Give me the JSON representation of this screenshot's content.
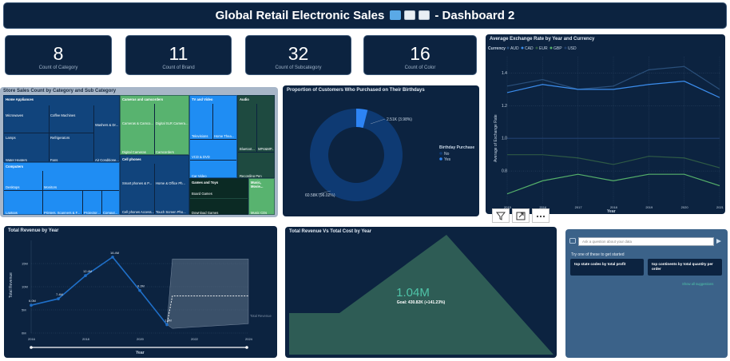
{
  "header": {
    "title_left": "Global Retail Electronic Sales",
    "title_right": "- Dashboard 2"
  },
  "kpis": [
    {
      "value": "8",
      "label": "Count of Category"
    },
    {
      "value": "11",
      "label": "Count of Brand"
    },
    {
      "value": "32",
      "label": "Count of Subcategory"
    },
    {
      "value": "16",
      "label": "Count of Color"
    }
  ],
  "treemap": {
    "title": "Store Sales Count by Category and Sub Category",
    "blocks": {
      "home_appliances": "Home Appliances",
      "microwaves": "Microwaves",
      "coffee_machines": "Coffee Machines",
      "lamps": "Lamps",
      "refrigerators": "Refrigerators",
      "washers": "Washers & Dr...",
      "water_heaters": "Water Heaters",
      "fans": "Fans",
      "air_conditioners": "Air Conditione...",
      "cameras": "Cameras and camcorders",
      "cameras_camco": "Cameras & Camco...",
      "digital_slr": "Digital SLR Camera...",
      "digital_cameras": "Digital Cameras",
      "camcorders": "Camcorders",
      "tv_video": "TV and Video",
      "televisions": "Televisions",
      "home_theater": "Home Thea...",
      "vcd_dvd": "VCD & DVD",
      "car_video": "Car Video",
      "audio": "Audio",
      "bluetooth": "Bluetoot...",
      "mp4": "MP4&MP...",
      "recording_pen": "Recording Pen",
      "computers": "Computers",
      "desktops": "Desktops",
      "monitors": "Monitors",
      "laptops": "Laptops",
      "printers": "Printers, Scanners & F...",
      "projectors": "Projector...",
      "computers_acc": "Comput...",
      "cell_phones": "Cell phones",
      "smart_phones": "Smart phones & P...",
      "home_office": "Home & Office Ph...",
      "cell_phones_acc": "Cell phones Access...",
      "touch_screen": "Touch Screen Pho...",
      "games": "Games and Toys",
      "board_games": "Board Games",
      "download_games": "Download Games",
      "music": "Music, Movie...",
      "music_cds": "Music CDs"
    }
  },
  "donut": {
    "title": "Proportion of Customers Who Purchased on Their Birthdays",
    "label_yes": "2.51K (3.98%)",
    "label_no": "60.58K (96.02%)",
    "legend_title": "Birthday Purchase",
    "legend": [
      "No",
      "Yes"
    ],
    "colors": {
      "no": "#0e3a73",
      "yes": "#2d84f5"
    },
    "chart_data": {
      "type": "pie",
      "categories": [
        "No",
        "Yes"
      ],
      "values": [
        60580,
        2510
      ]
    }
  },
  "fx": {
    "title": "Average Exchange Rate by Year and Currency",
    "legend_label": "Currency",
    "currencies": [
      "AUD",
      "CAD",
      "EUR",
      "GBP",
      "USD"
    ],
    "ylabel": "Average of Exchange Rate",
    "xlabel": "Year",
    "yticks": [
      "1.4",
      "1.2",
      "1.0",
      "0.8"
    ],
    "xticks": [
      "2015",
      "2016",
      "2017",
      "2018",
      "2019",
      "2020",
      "2021"
    ],
    "chart_data": {
      "type": "line",
      "x": [
        2015,
        2016,
        2017,
        2018,
        2019,
        2020,
        2021
      ],
      "series": [
        {
          "name": "AUD",
          "values": [
            1.32,
            1.36,
            1.3,
            1.32,
            1.42,
            1.44,
            1.3
          ]
        },
        {
          "name": "CAD",
          "values": [
            1.28,
            1.33,
            1.3,
            1.3,
            1.33,
            1.35,
            1.25
          ]
        },
        {
          "name": "EUR",
          "values": [
            0.9,
            0.9,
            0.88,
            0.84,
            0.89,
            0.88,
            0.82
          ]
        },
        {
          "name": "GBP",
          "values": [
            0.66,
            0.74,
            0.78,
            0.74,
            0.78,
            0.78,
            0.71
          ]
        },
        {
          "name": "USD",
          "values": [
            1.0,
            1.0,
            1.0,
            1.0,
            1.0,
            1.0,
            1.0
          ]
        }
      ],
      "ylim": [
        0.6,
        1.5
      ]
    }
  },
  "revenue": {
    "title": "Total Revenue by Year",
    "ylabel": "Total Revenue",
    "xlabel": "Year",
    "yticks": [
      "15M",
      "10M",
      "5M",
      "0M"
    ],
    "xticks": [
      "2016",
      "2017",
      "2018",
      "2019",
      "2020",
      "2021",
      "2022",
      "2023",
      "2024"
    ],
    "point_labels": [
      "6.0M",
      "7.4M",
      "12.4M",
      "16.4M",
      "9.2M",
      "1.8M"
    ],
    "forecast_label": "Total Revenue",
    "chart_data": {
      "type": "line",
      "x": [
        2016,
        2017,
        2018,
        2019,
        2020,
        2021
      ],
      "values": [
        6.0,
        7.4,
        12.4,
        16.4,
        9.2,
        1.8
      ],
      "ylim": [
        0,
        20
      ]
    }
  },
  "area": {
    "title": "Total Revenue Vs Total Cost by Year",
    "kpi_value": "1.04M",
    "kpi_goal": "Goal: 430.82K (+141.23%)"
  },
  "qa": {
    "placeholder": "Ask a question about your data",
    "hint": "Try one of these to get started",
    "suggestions": [
      "top state codes by total profit",
      "top continents by total quantity per order"
    ],
    "link": "Show all suggestions"
  }
}
